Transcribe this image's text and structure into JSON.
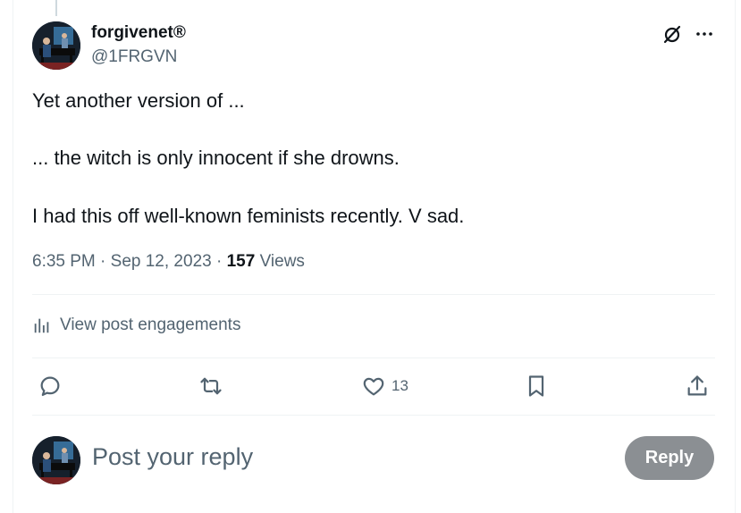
{
  "post": {
    "author": {
      "name": "forgivenet®",
      "handle": "@1FRGVN",
      "avatar": "pianist-avatar"
    },
    "text": {
      "line1": "Yet another version of ...",
      "line2": "... the witch is only innocent if she drowns.",
      "line3": "I had this off well-known feminists recently. V sad."
    },
    "time": "6:35 PM",
    "date": "Sep 12, 2023",
    "views_count": "157",
    "views_label": "Views",
    "separator": " · ",
    "engagements_label": "View post engagements",
    "actions": {
      "reply_icon": "reply-icon",
      "repost_icon": "repost-icon",
      "like_icon": "heart-icon",
      "like_count": "13",
      "bookmark_icon": "bookmark-icon",
      "share_icon": "share-icon"
    },
    "header_icons": [
      "grok-icon",
      "more-icon"
    ]
  },
  "reply_box": {
    "placeholder": "Post your reply",
    "button_label": "Reply"
  },
  "colors": {
    "text": "#0f1419",
    "secondary": "#536471",
    "divider": "#eff3f4",
    "reply_button": "#8b8f93"
  }
}
